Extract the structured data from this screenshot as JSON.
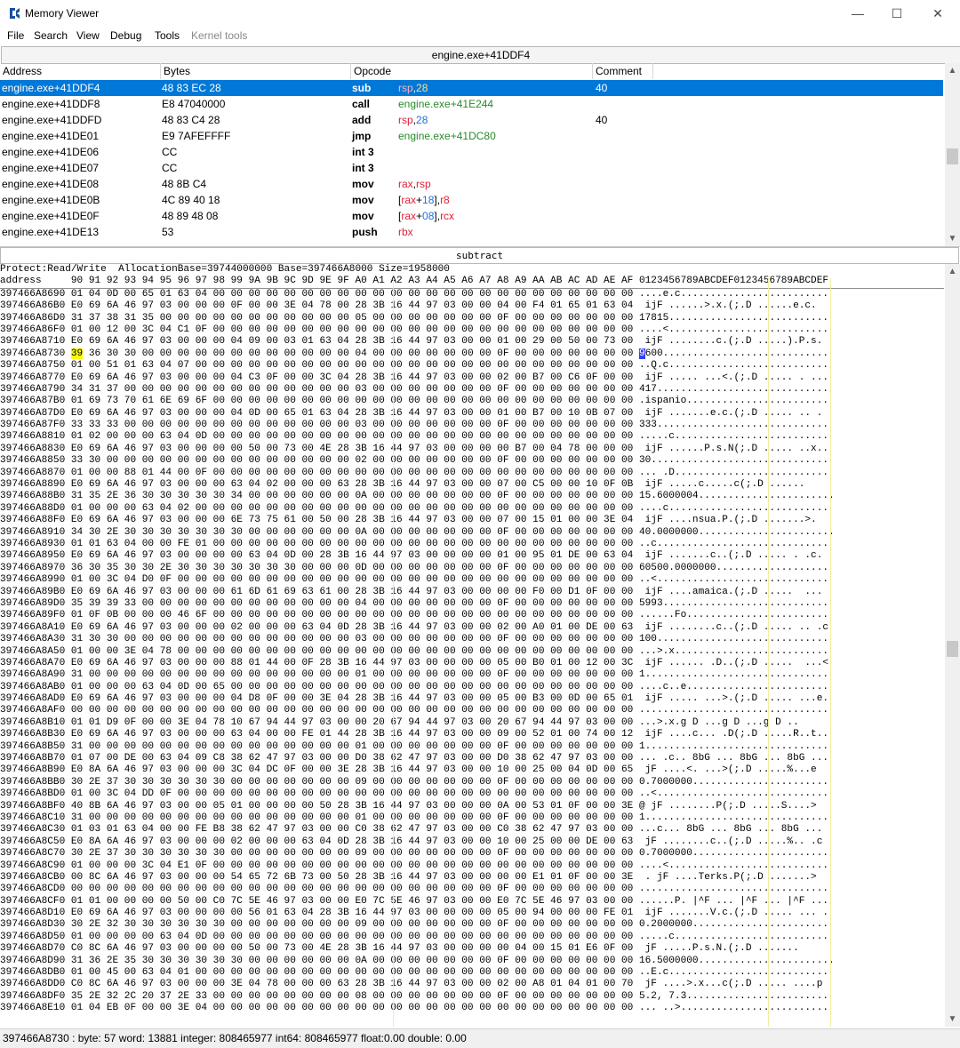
{
  "window": {
    "title": "Memory Viewer",
    "minimize": "—",
    "maximize": "☐",
    "close": "✕"
  },
  "menu": [
    "File",
    "Search",
    "View",
    "Debug",
    "Tools",
    "Kernel tools"
  ],
  "disasm": {
    "header": "engine.exe+41DDF4",
    "columns": {
      "address": "Address",
      "bytes": "Bytes",
      "opcode": "Opcode",
      "comment": "Comment"
    },
    "rows": [
      {
        "address": "engine.exe+41DDF4",
        "bytes": "48 83 EC 28",
        "mnemonic": "sub",
        "operands": [
          {
            "t": "rsp",
            "c": "reg"
          },
          {
            "t": ",",
            "c": ""
          },
          {
            "t": "28",
            "c": "num"
          }
        ],
        "comment": "40"
      },
      {
        "address": "engine.exe+41DDF8",
        "bytes": "E8 47040000",
        "mnemonic": "call",
        "operands": [
          {
            "t": "engine.exe+41E244",
            "c": "tgt"
          }
        ],
        "comment": ""
      },
      {
        "address": "engine.exe+41DDFD",
        "bytes": "48 83 C4 28",
        "mnemonic": "add",
        "operands": [
          {
            "t": "rsp",
            "c": "reg"
          },
          {
            "t": ",",
            "c": ""
          },
          {
            "t": "28",
            "c": "num"
          }
        ],
        "comment": "40"
      },
      {
        "address": "engine.exe+41DE01",
        "bytes": "E9 7AFEFFFF",
        "mnemonic": "jmp",
        "operands": [
          {
            "t": "engine.exe+41DC80",
            "c": "tgt"
          }
        ],
        "comment": ""
      },
      {
        "address": "engine.exe+41DE06",
        "bytes": "CC",
        "mnemonic": "int 3",
        "operands": [],
        "comment": ""
      },
      {
        "address": "engine.exe+41DE07",
        "bytes": "CC",
        "mnemonic": "int 3",
        "operands": [],
        "comment": ""
      },
      {
        "address": "engine.exe+41DE08",
        "bytes": "48 8B C4",
        "mnemonic": "mov",
        "operands": [
          {
            "t": "rax",
            "c": "reg"
          },
          {
            "t": ",",
            "c": ""
          },
          {
            "t": "rsp",
            "c": "reg"
          }
        ],
        "comment": ""
      },
      {
        "address": "engine.exe+41DE0B",
        "bytes": "4C 89 40 18",
        "mnemonic": "mov",
        "operands": [
          {
            "t": "[",
            "c": ""
          },
          {
            "t": "rax",
            "c": "reg"
          },
          {
            "t": "+",
            "c": ""
          },
          {
            "t": "18",
            "c": "num"
          },
          {
            "t": "],",
            "c": ""
          },
          {
            "t": "r8",
            "c": "reg"
          }
        ],
        "comment": ""
      },
      {
        "address": "engine.exe+41DE0F",
        "bytes": "48 89 48 08",
        "mnemonic": "mov",
        "operands": [
          {
            "t": "[",
            "c": ""
          },
          {
            "t": "rax",
            "c": "reg"
          },
          {
            "t": "+",
            "c": ""
          },
          {
            "t": "08",
            "c": "num"
          },
          {
            "t": "],",
            "c": ""
          },
          {
            "t": "rcx",
            "c": "reg"
          }
        ],
        "comment": ""
      },
      {
        "address": "engine.exe+41DE13",
        "bytes": "53",
        "mnemonic": "push",
        "operands": [
          {
            "t": "rbx",
            "c": "reg"
          }
        ],
        "comment": ""
      }
    ]
  },
  "subtract_label": "subtract",
  "hex": {
    "info": "Protect:Read/Write  AllocationBase=39744000000 Base=397466A8000 Size=1958000",
    "header": "address     90 91 92 93 94 95 96 97 98 99 9A 9B 9C 9D 9E 9F A0 A1 A2 A3 A4 A5 A6 A7 A8 A9 AA AB AC AD AE AF 0123456789ABCDEF0123456789ABCDEF",
    "lines": [
      "397466A8690 01 04 0D 00 65 01 63 04 00 00 00 00 00 00 00 00 00 00 00 00 00 00 00 00 00 00 00 00 00 00 00 00 ....e.c.........................",
      "397466A86B0 E0 69 6A 46 97 03 00 00 00 0F 00 00 3E 04 78 00 28 3B 16 44 97 03 00 00 04 00 F4 01 65 01 63 04  ijF ......>.x.(;.D ......e.c.",
      "397466A86D0 31 37 38 31 35 00 00 00 00 00 00 00 00 00 00 00 05 00 00 00 00 00 00 00 0F 00 00 00 00 00 00 00 17815...........................",
      "397466A86F0 01 00 12 00 3C 04 C1 0F 00 00 00 00 00 00 00 00 00 00 00 00 00 00 00 00 00 00 00 00 00 00 00 00 ....<...........................",
      "397466A8710 E0 69 6A 46 97 03 00 00 00 04 09 00 03 01 63 04 28 3B 16 44 97 03 00 00 01 00 29 00 50 00 73 00  ijF ........c.(;.D .....).P.s.",
      "397466A8730 39 36 30 30 00 00 00 00 00 00 00 00 00 00 00 00 04 00 00 00 00 00 00 00 0F 00 00 00 00 00 00 00 9600............................",
      "397466A8750 01 00 51 01 63 04 07 00 00 00 00 00 00 00 00 00 00 00 00 00 00 00 00 00 00 00 00 00 00 00 00 00 ..Q.c...........................",
      "397466A8770 E0 69 6A 46 97 03 00 00 00 04 C3 0F 00 00 3C 04 28 3B 16 44 97 03 00 00 02 00 B7 00 C6 0F 00 00  ijF ..... ...<.(;.D ..... . ...",
      "397466A8790 34 31 37 00 00 00 00 00 00 00 00 00 00 00 00 00 03 00 00 00 00 00 00 00 0F 00 00 00 00 00 00 00 417.............................",
      "397466A87B0 01 69 73 70 61 6E 69 6F 00 00 00 00 00 00 00 00 00 00 00 00 00 00 00 00 00 00 00 00 00 00 00 00 .ispanio........................",
      "397466A87D0 E0 69 6A 46 97 03 00 00 00 04 0D 00 65 01 63 04 28 3B 16 44 97 03 00 00 01 00 B7 00 10 0B 07 00  ijF .......e.c.(;.D ..... .. .",
      "397466A87F0 33 33 33 00 00 00 00 00 00 00 00 00 00 00 00 00 03 00 00 00 00 00 00 00 0F 00 00 00 00 00 00 00 333.............................",
      "397466A8810 01 02 00 00 00 63 04 0D 00 00 00 00 00 00 00 00 00 00 00 00 00 00 00 00 00 00 00 00 00 00 00 00 .....c..........................",
      "397466A8830 E0 69 6A 46 97 03 00 00 00 00 50 00 73 00 4E 28 3B 16 44 97 03 00 00 00 00 B7 00 04 78 00 00 00  ijF ......P.s.N(;.D ..... ..x..",
      "397466A8850 33 30 00 00 00 00 00 00 00 00 00 00 00 00 00 00 02 00 00 00 00 00 00 00 0F 00 00 00 00 00 00 00 30..............................",
      "397466A8870 01 00 00 88 01 44 00 0F 00 00 00 00 00 00 00 00 00 00 00 00 00 00 00 00 00 00 00 00 00 00 00 00 ... .D..........................",
      "397466A8890 E0 69 6A 46 97 03 00 00 00 63 04 02 00 00 00 63 28 3B 16 44 97 03 00 00 07 00 C5 00 00 10 0F 0B  ijF .....c.....c(;.D ......",
      "397466A88B0 31 35 2E 36 30 30 30 30 30 34 00 00 00 00 00 00 0A 00 00 00 00 00 00 00 0F 00 00 00 00 00 00 00 15.6000004.......................",
      "397466A88D0 01 00 00 00 63 04 02 00 00 00 00 00 00 00 00 00 00 00 00 00 00 00 00 00 00 00 00 00 00 00 00 00 ....c...........................",
      "397466A88F0 E0 69 6A 46 97 03 00 00 00 6E 73 75 61 00 50 00 28 3B 16 44 97 03 00 00 07 00 15 01 00 00 3E 04  ijF ....nsua.P.(;.D .......>.",
      "397466A8910 34 30 2E 30 30 30 30 30 30 30 00 00 00 00 00 00 0A 00 00 00 00 00 00 00 0F 00 00 00 00 00 00 00 40.0000000.......................",
      "397466A8930 01 01 63 04 00 00 FE 01 00 00 00 00 00 00 00 00 00 00 00 00 00 00 00 00 00 00 00 00 00 00 00 00 ..c.............................",
      "397466A8950 E0 69 6A 46 97 03 00 00 00 00 63 04 0D 00 28 3B 16 44 97 03 00 00 00 00 01 00 95 01 DE 00 63 04  ijF .......c..(;.D ..... . .c.",
      "397466A8970 36 30 35 30 30 2E 30 30 30 30 30 30 30 00 00 00 0D 00 00 00 00 00 00 00 0F 00 00 00 00 00 00 00 60500.0000000...................",
      "397466A8990 01 00 3C 04 D0 0F 00 00 00 00 00 00 00 00 00 00 00 00 00 00 00 00 00 00 00 00 00 00 00 00 00 00 ..<.............................",
      "397466A89B0 E0 69 6A 46 97 03 00 00 00 61 6D 61 69 63 61 00 28 3B 16 44 97 03 00 00 00 00 F0 00 D1 0F 00 00  ijF ....amaica.(;.D .....  ...",
      "397466A89D0 35 39 39 33 00 00 00 00 00 00 00 00 00 00 00 00 04 00 00 00 00 00 00 00 0F 00 00 00 00 00 00 00 5993............................",
      "397466A89F0 01 0F 0B 00 00 00 46 6F 00 00 00 00 00 00 00 00 00 00 00 00 00 00 00 00 00 00 00 00 00 00 00 00 ......Fo........................",
      "397466A8A10 E0 69 6A 46 97 03 00 00 00 02 00 00 00 63 04 0D 28 3B 16 44 97 03 00 00 02 00 A0 01 00 DE 00 63  ijF ........c..(;.D ..... .. .c",
      "397466A8A30 31 30 30 00 00 00 00 00 00 00 00 00 00 00 00 00 03 00 00 00 00 00 00 00 0F 00 00 00 00 00 00 00 100.............................",
      "397466A8A50 01 00 00 3E 04 78 00 00 00 00 00 00 00 00 00 00 00 00 00 00 00 00 00 00 00 00 00 00 00 00 00 00 ...>.x..........................",
      "397466A8A70 E0 69 6A 46 97 03 00 00 00 88 01 44 00 0F 28 3B 16 44 97 03 00 00 00 00 05 00 B0 01 00 12 00 3C  ijF ...... .D..(;.D .....  ...<",
      "397466A8A90 31 00 00 00 00 00 00 00 00 00 00 00 00 00 00 00 01 00 00 00 00 00 00 00 0F 00 00 00 00 00 00 00 1...............................",
      "397466A8AB0 01 00 00 00 63 04 0D 00 65 00 00 00 00 00 00 00 00 00 00 00 00 00 00 00 00 00 00 00 00 00 00 00 ....c..e........................",
      "397466A8AD0 E0 69 6A 46 97 03 00 00 00 04 D8 0F 00 00 3E 04 28 3B 16 44 97 03 00 00 05 00 B3 00 0D 00 65 01  ijF ..... ...>.(;.D ..... ...e.",
      "397466A8AF0 00 00 00 00 00 00 00 00 00 00 00 00 00 00 00 00 00 00 00 00 00 00 00 00 00 00 00 00 00 00 00 00 ................................",
      "397466A8B10 01 01 D9 0F 00 00 3E 04 78 10 67 94 44 97 03 00 00 20 67 94 44 97 03 00 20 67 94 44 97 03 00 00 ...>.x.g D ...g D ...g D ..",
      "397466A8B30 E0 69 6A 46 97 03 00 00 00 63 04 00 00 FE 01 44 28 3B 16 44 97 03 00 00 09 00 52 01 00 74 00 12  ijF ....c... .D(;.D .....R..t..",
      "397466A8B50 31 00 00 00 00 00 00 00 00 00 00 00 00 00 00 00 01 00 00 00 00 00 00 00 0F 00 00 00 00 00 00 00 1...............................",
      "397466A8B70 01 07 00 DE 00 63 04 09 C8 38 62 47 97 03 00 00 D0 38 62 47 97 03 00 00 D0 38 62 47 97 03 00 00 ... .c.. 8bG ... 8bG ... 8bG ...",
      "397466A8B90 E0 8A 6A 46 97 03 00 00 00 3C 04 DC 0F 00 00 3E 28 3B 16 44 97 03 00 00 10 00 25 00 04 0D 00 65  jF ....<. ...>(;.D .....%...e",
      "397466A8BB0 30 2E 37 30 30 30 30 30 30 00 00 00 00 00 00 00 09 00 00 00 00 00 00 00 0F 00 00 00 00 00 00 00 0.7000000.......................",
      "397466A8BD0 01 00 3C 04 DD 0F 00 00 00 00 00 00 00 00 00 00 00 00 00 00 00 00 00 00 00 00 00 00 00 00 00 00 ..<.............................",
      "397466A8BF0 40 8B 6A 46 97 03 00 00 05 01 00 00 00 00 50 28 3B 16 44 97 03 00 00 00 0A 00 53 01 0F 00 00 3E @ jF ........P(;.D .....S....>",
      "397466A8C10 31 00 00 00 00 00 00 00 00 00 00 00 00 00 00 00 01 00 00 00 00 00 00 00 0F 00 00 00 00 00 00 00 1...............................",
      "397466A8C30 01 03 01 63 04 00 00 FE B8 38 62 47 97 03 00 00 C0 38 62 47 97 03 00 00 C0 38 62 47 97 03 00 00 ...c... 8bG ... 8bG ... 8bG ...",
      "397466A8C50 E0 8A 6A 46 97 03 00 00 00 02 00 00 00 63 04 0D 28 3B 16 44 97 03 00 00 10 00 25 00 00 DE 00 63  jF ........c..(;.D .....%.. .c",
      "397466A8C70 30 2E 37 30 30 30 30 30 30 00 00 00 00 00 00 00 09 00 00 00 00 00 00 00 0F 00 00 00 00 00 00 00 0.7000000.......................",
      "397466A8C90 01 00 00 00 3C 04 E1 0F 00 00 00 00 00 00 00 00 00 00 00 00 00 00 00 00 00 00 00 00 00 00 00 00 ....<...........................",
      "397466A8CB0 00 8C 6A 46 97 03 00 00 00 54 65 72 6B 73 00 50 28 3B 16 44 97 03 00 00 00 00 E1 01 0F 00 00 3E  . jF ....Terks.P(;.D .......>",
      "397466A8CD0 00 00 00 00 00 00 00 00 00 00 00 00 00 00 00 00 00 00 00 00 00 00 00 00 0F 00 00 00 00 00 00 00 ................................",
      "397466A8CF0 01 01 00 00 00 00 50 00 C0 7C 5E 46 97 03 00 00 E0 7C 5E 46 97 03 00 00 E0 7C 5E 46 97 03 00 00 ......P. |^F ... |^F ... |^F ...",
      "397466A8D10 E0 69 6A 46 97 03 00 00 00 00 56 01 63 04 28 3B 16 44 97 03 00 00 00 00 05 00 94 00 00 00 FE 01  ijF .......V.c.(;.D ..... ... .",
      "397466A8D30 30 2E 32 30 30 30 30 30 30 00 00 00 00 00 00 00 09 00 00 00 00 00 00 00 0F 00 00 00 00 00 00 00 0.2000000.......................",
      "397466A8D50 01 00 00 00 00 63 04 0D 00 00 00 00 00 00 00 00 00 00 00 00 00 00 00 00 00 00 00 00 00 00 00 00 .....c..........................",
      "397466A8D70 C0 8C 6A 46 97 03 00 00 00 00 50 00 73 00 4E 28 3B 16 44 97 03 00 00 00 00 04 00 15 01 E6 0F 00  jF .....P.s.N.(;.D .......",
      "397466A8D90 31 36 2E 35 30 30 30 30 30 30 00 00 00 00 00 00 0A 00 00 00 00 00 00 00 0F 00 00 00 00 00 00 00 16.5000000.......................",
      "397466A8DB0 01 00 45 00 63 04 01 00 00 00 00 00 00 00 00 00 00 00 00 00 00 00 00 00 00 00 00 00 00 00 00 00 ..E.c...........................",
      "397466A8DD0 C0 8C 6A 46 97 03 00 00 00 3E 04 78 00 00 00 63 28 3B 16 44 97 03 00 00 02 00 A8 01 04 01 00 70  jF ....>.x...c(;.D ..... ....p",
      "397466A8DF0 35 2E 32 2C 20 37 2E 33 00 00 00 00 00 00 00 00 08 00 00 00 00 00 00 00 0F 00 00 00 00 00 00 00 5.2, 7.3........................",
      "397466A8E10 01 04 EB 0F 00 00 3E 04 00 00 00 00 00 00 00 00 00 00 00 00 00 00 00 00 00 00 00 00 00 00 00 00 ... ..>........................."
    ]
  },
  "status": "397466A8730 : byte: 57 word: 13881 integer: 808465977 int64: 808465977 float:0.00 double: 0.00"
}
